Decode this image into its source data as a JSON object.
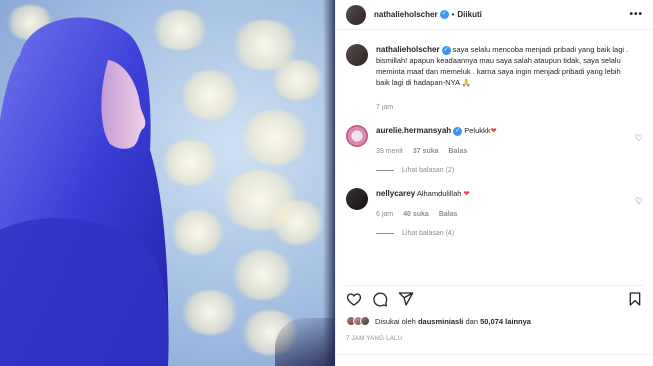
{
  "post": {
    "username": "nathalieholscher",
    "verified_icon": "verified-badge-icon",
    "separator": "•",
    "follow_status": "Diikuti",
    "more_label": "•••"
  },
  "caption": {
    "username": "nathalieholscher",
    "text": "saya selalu mencoba menjadi pribadi yang baik lagi . bismillah! apapun keadaannya mau saya salah ataupun tidak, saya selalu meminta maaf dan memeluk . karna saya ingin menjadi pribadi yang lebih baik lagi di hadapan-NYA 🙏",
    "time": "7 jam"
  },
  "comments": [
    {
      "username": "aurelie.hermansyah",
      "verified": true,
      "text": "Pelukkk",
      "emoji": "❤",
      "time": "39 menit",
      "likes": "37 suka",
      "reply_label": "Balas",
      "view_replies": "Lihat balasan (2)"
    },
    {
      "username": "nellycarey",
      "verified": false,
      "text": "Alhamdulillah",
      "emoji": "❤",
      "time": "6 jam",
      "likes": "40 suka",
      "reply_label": "Balas",
      "view_replies": "Lihat balasan (4)"
    }
  ],
  "likes": {
    "prefix": "Disukai oleh",
    "user": "dausminiasli",
    "middle": "dan",
    "count": "50,074 lainnya"
  },
  "posted_ago": "7 JAM YANG LALU",
  "colors": {
    "verified": "#3897f0",
    "heart": "#ed4956",
    "hijab": "#3c3fd0"
  }
}
